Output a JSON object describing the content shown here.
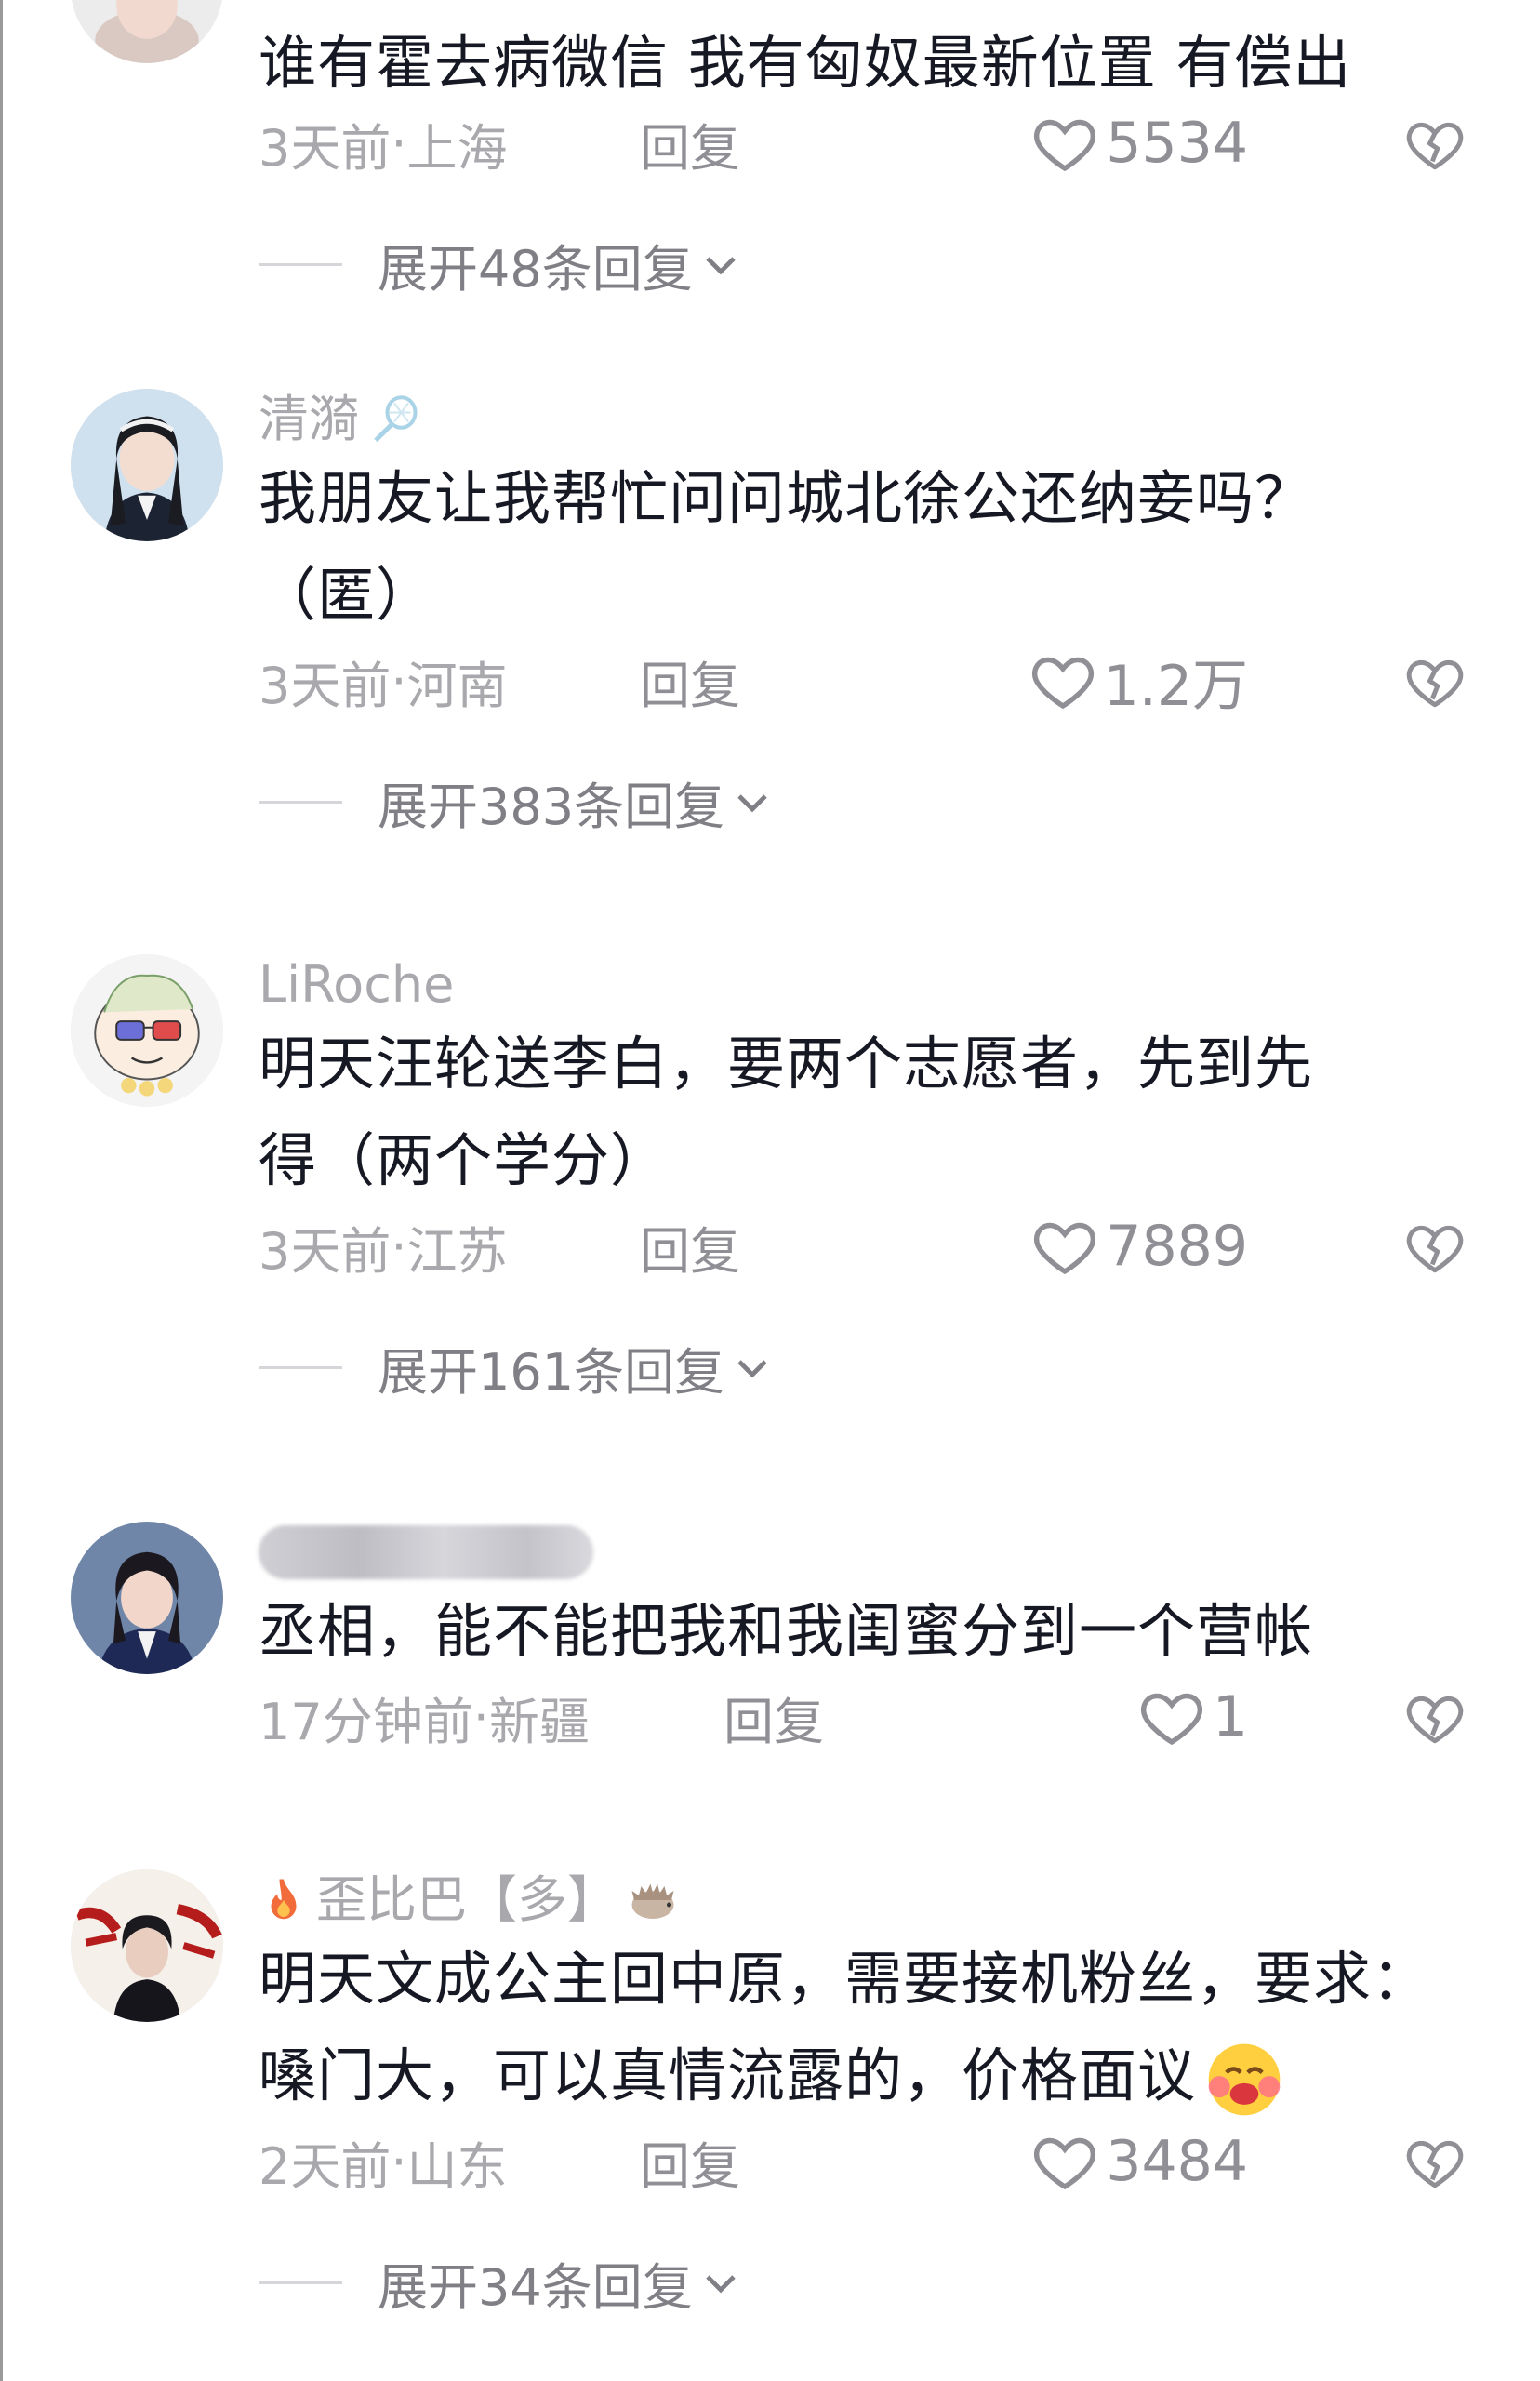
{
  "comments": [
    {
      "username": "",
      "text_lines": [
        "谁有霍去病微信 我有匈奴最新位置 有偿出"
      ],
      "time": "3天前",
      "location": "上海",
      "reply_label": "回复",
      "likes": "5534",
      "expand_label": "展开48条回复"
    },
    {
      "username": "清漪",
      "username_icon": "badminton-racket-icon",
      "text_lines": [
        "我朋友让我帮忙问问城北徐公还纳妾吗？",
        "（匿）"
      ],
      "time": "3天前",
      "location": "河南",
      "reply_label": "回复",
      "likes": "1.2万",
      "expand_label": "展开383条回复"
    },
    {
      "username": "LiRoche",
      "text_lines": [
        "明天汪轮送李白，要两个志愿者，先到先",
        "得（两个学分）"
      ],
      "time": "3天前",
      "location": "江苏",
      "reply_label": "回复",
      "likes": "7889",
      "expand_label": "展开161条回复"
    },
    {
      "username": "",
      "username_blurred": true,
      "text_lines": [
        "丞相，能不能把我和我闺蜜分到一个营帐"
      ],
      "time": "17分钟前",
      "location": "新疆",
      "reply_label": "回复",
      "likes": "1"
    },
    {
      "username": "歪比巴【多】",
      "username_prefix_icon": "fire-icon",
      "username_suffix_icon": "hedgehog-icon",
      "text_lines": [
        "明天文成公主回中原，需要接机粉丝，要求：",
        "嗓门大，可以真情流露的，价格面议"
      ],
      "text_suffix_icon": "crying-face-icon",
      "time": "2天前",
      "location": "山东",
      "reply_label": "回复",
      "likes": "3484",
      "expand_label": "展开34条回复"
    }
  ],
  "separator": " · ",
  "colors": {
    "text": "#161823",
    "meta": "#a8a8ad",
    "reply": "#8f8f95",
    "expand": "#7f7f85"
  }
}
